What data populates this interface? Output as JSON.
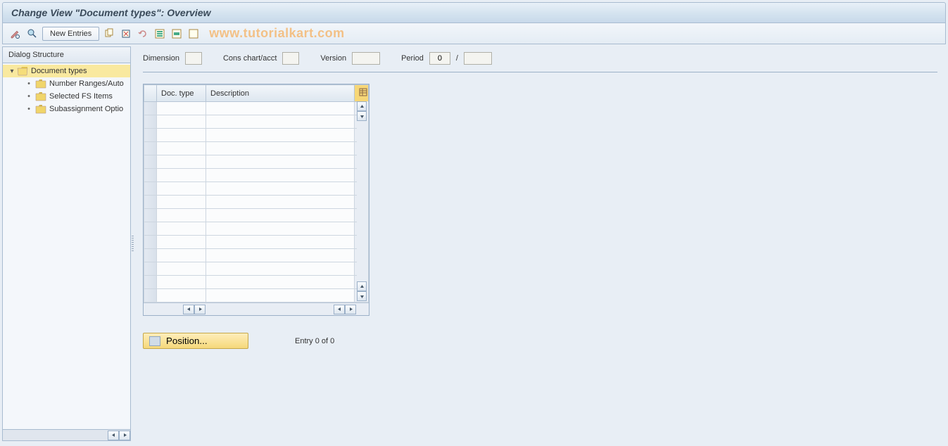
{
  "title": "Change View \"Document types\": Overview",
  "toolbar": {
    "new_entries_label": "New Entries"
  },
  "watermark": "www.tutorialkart.com",
  "sidebar": {
    "header": "Dialog Structure",
    "root": {
      "label": "Document types",
      "children": [
        {
          "label": "Number Ranges/Auto"
        },
        {
          "label": "Selected FS Items"
        },
        {
          "label": "Subassignment Optio"
        }
      ]
    }
  },
  "header_fields": {
    "dimension_label": "Dimension",
    "dimension_value": "",
    "cons_label": "Cons chart/acct",
    "cons_value": "",
    "version_label": "Version",
    "version_value": "",
    "period_label": "Period",
    "period_value1": "0",
    "period_sep": "/",
    "period_value2": ""
  },
  "table": {
    "col_doctype": "Doc. type",
    "col_desc": "Description",
    "row_count": 15
  },
  "footer": {
    "position_label": "Position...",
    "entry_text": "Entry 0 of 0"
  }
}
